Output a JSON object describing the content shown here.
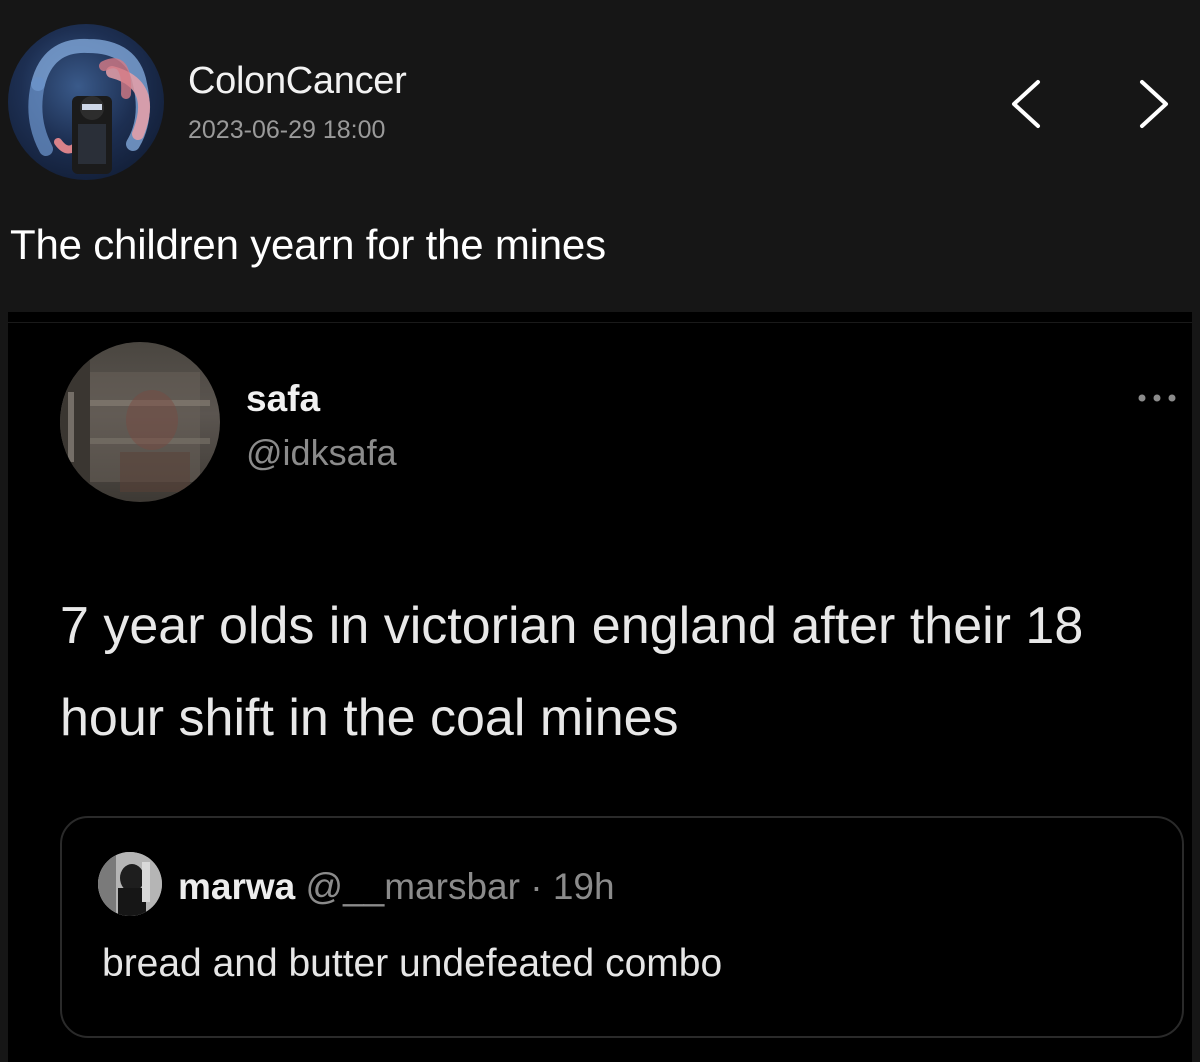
{
  "post": {
    "author": "ColonCancer",
    "timestamp": "2023-06-29 18:00",
    "caption": "The children yearn for the mines"
  },
  "nav": {
    "prev_icon": "chevron-left-icon",
    "next_icon": "chevron-right-icon"
  },
  "tweet": {
    "name": "safa",
    "handle": "@idksafa",
    "more_icon": "more-horizontal-icon",
    "text": "7 year olds in victorian england after their 18 hour shift in the coal mines",
    "quote": {
      "name": "marwa",
      "handle": "@__marsbar",
      "time": "· 19h",
      "text": "bread and butter undefeated combo"
    }
  },
  "colors": {
    "page_background": "#161616",
    "embed_background": "#000000",
    "muted_text": "#8b8b8b"
  }
}
